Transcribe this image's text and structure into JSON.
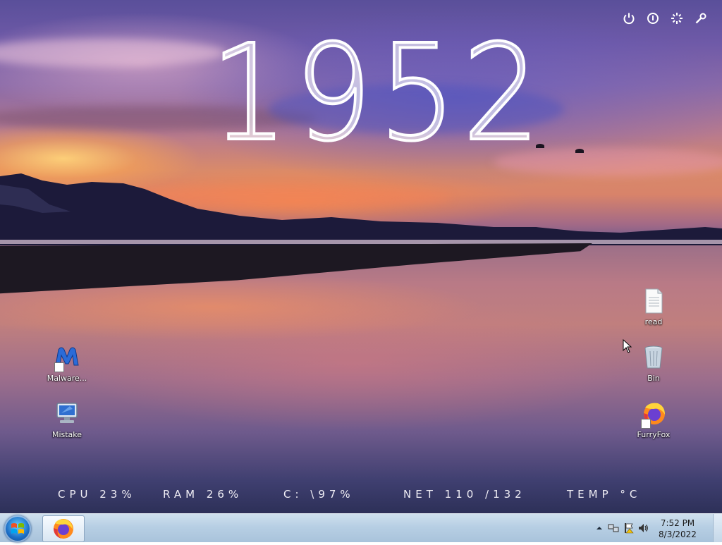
{
  "clock_widget": {
    "year": "1952"
  },
  "top_controls": [
    "power-icon",
    "info-icon",
    "settings-icon",
    "wrench-icon"
  ],
  "desktop_icons": {
    "left": [
      {
        "label": "Malware...",
        "icon": "malwarebytes-icon"
      },
      {
        "label": "Mistake",
        "icon": "computer-icon"
      }
    ],
    "right": [
      {
        "label": "read",
        "icon": "text-file-icon"
      },
      {
        "label": "Bin",
        "icon": "recycle-bin-icon"
      },
      {
        "label": "FurryFox",
        "icon": "firefox-icon"
      }
    ]
  },
  "stats": {
    "cpu": "CPU 23%",
    "ram": "RAM 26%",
    "disk": "C: \\97%",
    "net": "NET 110 /132",
    "temp": "TEMP °C"
  },
  "taskbar": {
    "pinned": [
      {
        "icon": "firefox-icon"
      }
    ],
    "tray": {
      "time": "7:52 PM",
      "date": "8/3/2022"
    }
  },
  "colors": {
    "taskbar": "#b7cfe4",
    "text": "#ffffff",
    "start_orb": "#1c6fc7"
  }
}
